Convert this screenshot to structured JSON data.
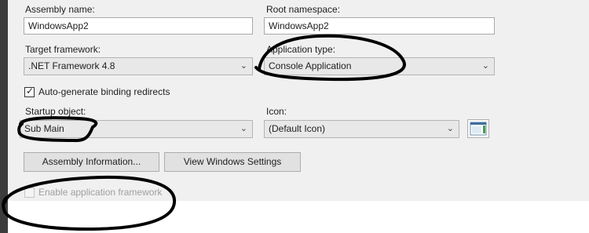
{
  "assembly_name": {
    "label": "Assembly name:",
    "value": "WindowsApp2"
  },
  "root_namespace": {
    "label": "Root namespace:",
    "value": "WindowsApp2"
  },
  "target_framework": {
    "label": "Target framework:",
    "value": ".NET Framework 4.8"
  },
  "application_type": {
    "label": "Application type:",
    "value": "Console Application"
  },
  "auto_generate": {
    "label": "Auto-generate binding redirects",
    "checked": true
  },
  "startup_object": {
    "label": "Startup object:",
    "value": "Sub Main"
  },
  "icon": {
    "label": "Icon:",
    "value": "(Default Icon)"
  },
  "buttons": {
    "assembly_info": "Assembly Information...",
    "view_windows_settings": "View Windows Settings"
  },
  "enable_app_framework": {
    "label": "Enable application framework",
    "checked": false,
    "enabled": false
  },
  "icons": {
    "dropdown": "chevron-down-icon",
    "check": "checkmark-icon",
    "icon_preview": "application-icon"
  },
  "colors": {
    "panel": "#f0f0f0",
    "annotation": "#000000"
  }
}
